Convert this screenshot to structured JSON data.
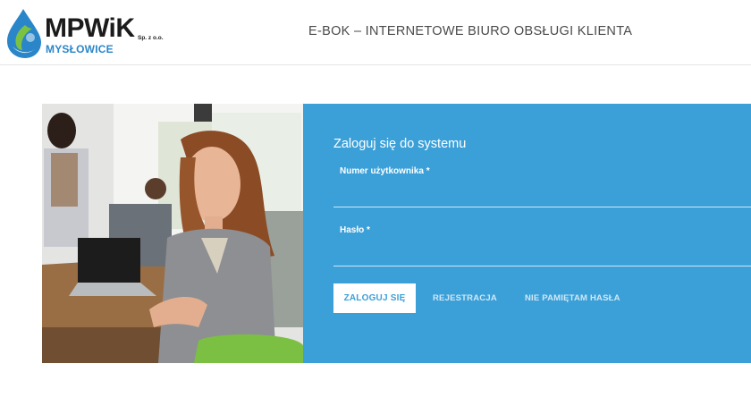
{
  "header": {
    "logo": {
      "name": "MPWiK",
      "suffix": "Sp. z o.o.",
      "city": "MYSŁOWICE"
    },
    "title": "E-BOK – INTERNETOWE BIURO OBSŁUGI KLIENTA"
  },
  "login": {
    "title": "Zaloguj się do systemu",
    "username_label": "Numer użytkownika *",
    "username_value": "",
    "password_label": "Hasło *",
    "password_value": "",
    "login_button": "ZALOGUJ SIĘ",
    "register_link": "REJESTRACJA",
    "forgot_link": "NIE PAMIĘTAM HASŁA"
  },
  "colors": {
    "panel_blue": "#3ca0d8",
    "logo_blue": "#2a86c9",
    "logo_green": "#7cc242"
  },
  "hero_image": "office-photo-smiling-woman-with-laptop"
}
